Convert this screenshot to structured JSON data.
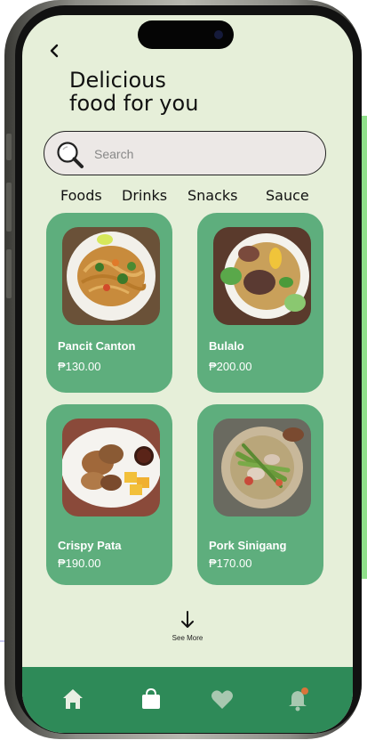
{
  "header": {
    "title": "Delicious\nfood for you"
  },
  "search": {
    "placeholder": "Search"
  },
  "tabs": [
    {
      "label": "Foods"
    },
    {
      "label": "Drinks"
    },
    {
      "label": "Snacks"
    },
    {
      "label": "Sauce"
    }
  ],
  "products": [
    {
      "name": "Pancit Canton",
      "price": "₱130.00"
    },
    {
      "name": "Bulalo",
      "price": "₱200.00"
    },
    {
      "name": "Crispy Pata",
      "price": "₱190.00"
    },
    {
      "name": "Pork Sinigang",
      "price": "₱170.00"
    }
  ],
  "see_more": {
    "label": "See More"
  },
  "bottom_nav": [
    {
      "icon": "home-icon"
    },
    {
      "icon": "shopping-bag-icon"
    },
    {
      "icon": "heart-icon"
    },
    {
      "icon": "bell-icon"
    }
  ],
  "colors": {
    "screen_bg": "#e6efd9",
    "card": "#5eae7d",
    "nav": "#2e8a58",
    "notification_dot": "#d9743a"
  }
}
